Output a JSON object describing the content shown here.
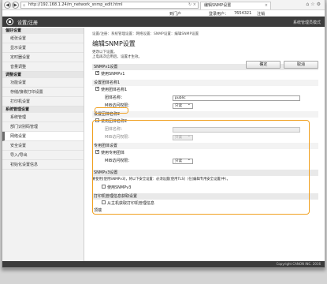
{
  "browser": {
    "url": "http://192.168.1.24/m_network_snmp_edit.html",
    "tab_title": "编辑SNMP设置",
    "back": "◀",
    "forward": "▶"
  },
  "topstrip": {
    "item1": "到门户",
    "item2": "登录用户：",
    "item3": "7654321",
    "item4": "注销"
  },
  "header": {
    "title": "设置/注册",
    "right": "系统管理员模式"
  },
  "sidebar": {
    "sec1": "偏好设置",
    "sec1_items": [
      "纸张设置",
      "显示设置",
      "定时器设置",
      "音量调整"
    ],
    "sec2": "调整设置",
    "sec2_items": [
      "功能设置",
      "存储/接收打印设置",
      "打印机设置"
    ],
    "sec3": "系统管理设置",
    "sec3_items": [
      "系统管理",
      "部门识别码管理",
      "网络设置",
      "安全设置",
      "导入/导出",
      "初始化设置信息"
    ]
  },
  "main": {
    "crumb": "设置/注册：系统管理设置：网络设置：SNMP设置：编辑SNMP设置",
    "title": "编辑SNMP设置",
    "hint1": "更改以下设置。",
    "hint2": "上电再次启用后，设置才生效。",
    "ok": "确定",
    "cancel": "取消",
    "snmpv1_head": "SNMPv1设置",
    "use_snmpv1": "使用SNMPv1",
    "community1_head": "设置团体名称1",
    "use_community1": "使用团体名称1",
    "community_name_label": "团体名称：",
    "community1_value": "public",
    "mib_label": "MIB访问权限：",
    "mib1_value": "只读",
    "community2_head": "设置团体名称2",
    "use_community2": "使用团体名称2",
    "community2_value": "",
    "mib2_value": "只读",
    "dedicated_head": "专用团体设置",
    "use_dedicated": "使用专用团体",
    "mib3_value": "只读",
    "snmpv3_head": "SNMPv3设置",
    "snmpv3_note": "要使用[使用SNMPv3]，将以下安全设置：必须设置[使用TLS]（在[编辑专用安全设置]中）。",
    "use_snmpv3": "使用SNMPv3",
    "printer_head": "打印机管理信息获取设置",
    "printer_item": "从主机获取打印机管理信息",
    "top": "顶端"
  },
  "footer": "Copyright CANON INC. 2016"
}
